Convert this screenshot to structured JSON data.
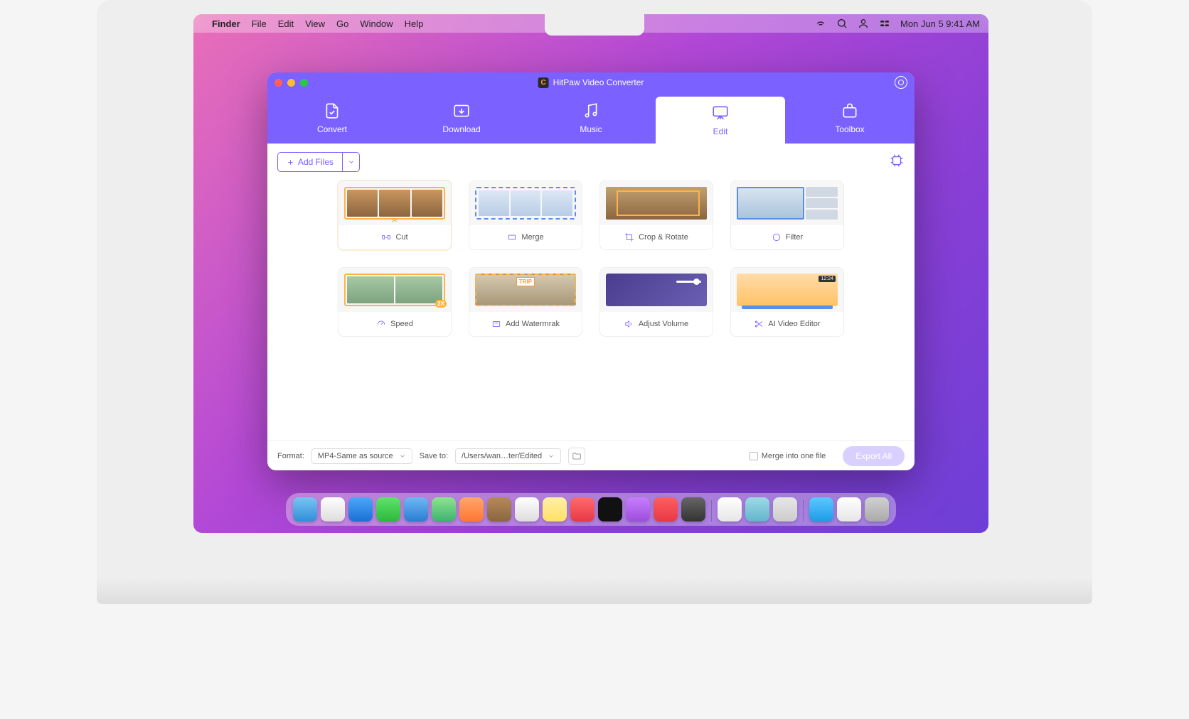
{
  "menubar": {
    "app": "Finder",
    "items": [
      "File",
      "Edit",
      "View",
      "Go",
      "Window",
      "Help"
    ],
    "datetime": "Mon Jun 5  9:41 AM"
  },
  "window": {
    "title": "HitPaw Video Converter"
  },
  "tabs": [
    {
      "label": "Convert"
    },
    {
      "label": "Download"
    },
    {
      "label": "Music"
    },
    {
      "label": "Edit"
    },
    {
      "label": "Toolbox"
    }
  ],
  "toolbar": {
    "add_files_label": "Add Files"
  },
  "cards": [
    {
      "label": "Cut"
    },
    {
      "label": "Merge"
    },
    {
      "label": "Crop & Rotate"
    },
    {
      "label": "Filter"
    },
    {
      "label": "Speed"
    },
    {
      "label": "Add Watermrak"
    },
    {
      "label": "Adjust Volume"
    },
    {
      "label": "AI Video Editor"
    }
  ],
  "thumb": {
    "watermark_text": "TRIP",
    "ai_timestamp": "12:24"
  },
  "footer": {
    "format_label": "Format:",
    "format_value": "MP4-Same as source",
    "save_to_label": "Save to:",
    "save_to_value": "/Users/wan…ter/Edited",
    "merge_label": "Merge into one file",
    "export_label": "Export All"
  },
  "dock_colors": [
    "linear-gradient(#79c4f2,#2f8fd8)",
    "linear-gradient(#fff,#ddd)",
    "linear-gradient(#4aa8f7,#1c6fd6)",
    "linear-gradient(#5fe36b,#2db83d)",
    "linear-gradient(#6fb8f5,#2a7dd1)",
    "linear-gradient(#8fe38f,#3cb371)",
    "linear-gradient(#ffa66b,#ff7733)",
    "linear-gradient(#b58a5a,#8c6540)",
    "linear-gradient(#fff,#ddd)",
    "linear-gradient(#fff0a6,#ffe066)",
    "linear-gradient(#ff6b6b,#e63946)",
    "#111",
    "linear-gradient(#c77dff,#9d4edd)",
    "linear-gradient(#ff5e5e,#e63946)",
    "linear-gradient(#666,#333)",
    "linear-gradient(#fff,#e6e6e6)",
    "linear-gradient(#9fd9e6,#62b5cc)",
    "linear-gradient(#e6e6e6,#ccc)",
    "linear-gradient(#5cc8ff,#1e9be6)",
    "linear-gradient(#fff,#e6e6e6)",
    "linear-gradient(#d0d0d0,#aaa)"
  ]
}
